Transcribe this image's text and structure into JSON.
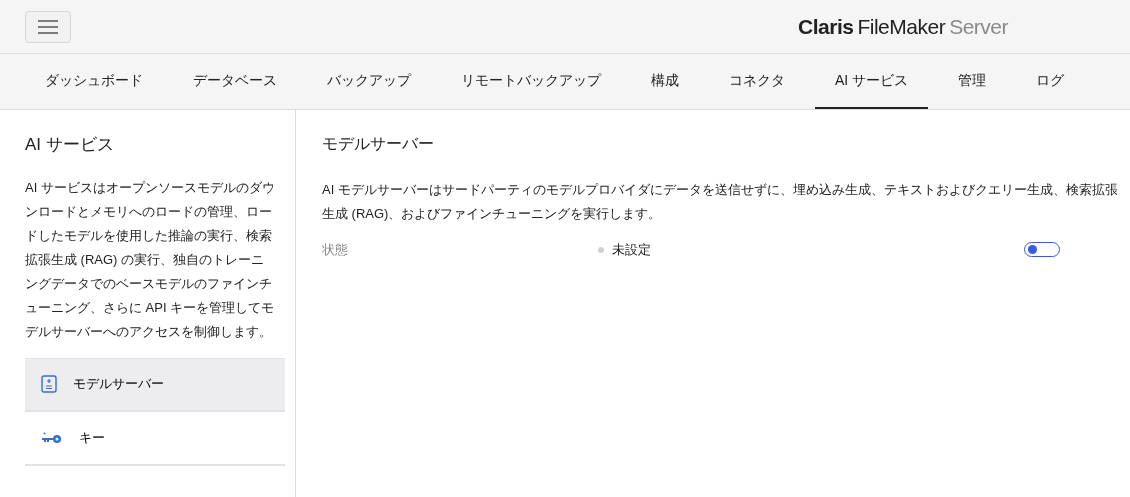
{
  "header": {
    "logo": {
      "brand": "Claris",
      "product": "FileMaker",
      "edition": "Server"
    }
  },
  "tabs": [
    {
      "label": "ダッシュボード",
      "selected": false
    },
    {
      "label": "データベース",
      "selected": false
    },
    {
      "label": "バックアップ",
      "selected": false
    },
    {
      "label": "リモートバックアップ",
      "selected": false
    },
    {
      "label": "構成",
      "selected": false
    },
    {
      "label": "コネクタ",
      "selected": false
    },
    {
      "label": "AI サービス",
      "selected": true
    },
    {
      "label": "管理",
      "selected": false
    },
    {
      "label": "ログ",
      "selected": false
    }
  ],
  "sidebar": {
    "title": "AI サービス",
    "description": "AI サービスはオープンソースモデルのダウンロードとメモリへのロードの管理、ロードしたモデルを使用した推論の実行、検索拡張生成 (RAG) の実行、独自のトレーニングデータでのベースモデルのファインチューニング、さらに API キーを管理してモデルサーバーへのアクセスを制御します。",
    "items": [
      {
        "label": "モデルサーバー",
        "kind": "server",
        "selected": true
      },
      {
        "label": "キー",
        "kind": "key",
        "selected": false
      }
    ]
  },
  "main": {
    "title": "モデルサーバー",
    "description": "AI モデルサーバーはサードパーティのモデルプロバイダにデータを送信せずに、埋め込み生成、テキストおよびクエリー生成、検索拡張生成 (RAG)、およびファインチューニングを実行します。",
    "status": {
      "label": "状態",
      "value": "未設定",
      "color": "#d0d0d0",
      "on": false
    }
  }
}
